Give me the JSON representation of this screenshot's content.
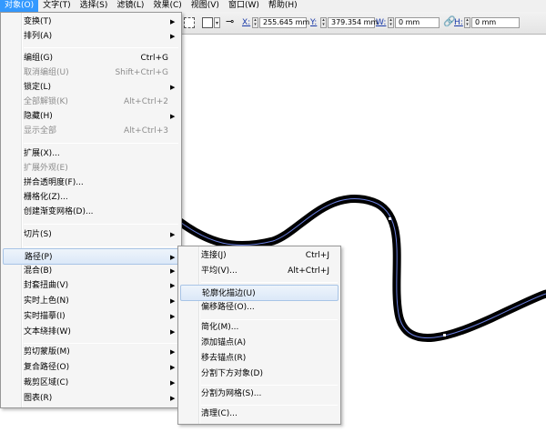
{
  "menubar": [
    {
      "label": "对象(O)",
      "active": true
    },
    {
      "label": "文字(T)"
    },
    {
      "label": "选择(S)"
    },
    {
      "label": "滤镜(L)"
    },
    {
      "label": "效果(C)"
    },
    {
      "label": "视图(V)"
    },
    {
      "label": "窗口(W)"
    },
    {
      "label": "帮助(H)"
    }
  ],
  "toolbar": {
    "x_label": "X:",
    "x_value": "255.645 mm",
    "y_label": "Y:",
    "y_value": "379.354 mm",
    "w_label": "W:",
    "w_value": "0 mm",
    "h_label": "H:",
    "h_value": "0 mm"
  },
  "object_menu": [
    {
      "label": "变换(T)",
      "submenu": true
    },
    {
      "label": "排列(A)",
      "submenu": true
    },
    {
      "separator": true
    },
    {
      "label": "编组(G)",
      "shortcut": "Ctrl+G"
    },
    {
      "label": "取消编组(U)",
      "shortcut": "Shift+Ctrl+G",
      "disabled": true
    },
    {
      "label": "锁定(L)",
      "submenu": true
    },
    {
      "label": "全部解锁(K)",
      "shortcut": "Alt+Ctrl+2",
      "disabled": true
    },
    {
      "label": "隐藏(H)",
      "submenu": true
    },
    {
      "label": "显示全部",
      "shortcut": "Alt+Ctrl+3",
      "disabled": true
    },
    {
      "separator": true
    },
    {
      "label": "扩展(X)..."
    },
    {
      "label": "扩展外观(E)",
      "disabled": true
    },
    {
      "label": "拼合透明度(F)..."
    },
    {
      "label": "栅格化(Z)..."
    },
    {
      "label": "创建渐变网格(D)..."
    },
    {
      "separator": true
    },
    {
      "label": "切片(S)",
      "submenu": true
    },
    {
      "separator": true
    },
    {
      "label": "路径(P)",
      "submenu": true,
      "highlighted": true
    },
    {
      "label": "混合(B)",
      "submenu": true
    },
    {
      "label": "封套扭曲(V)",
      "submenu": true
    },
    {
      "label": "实时上色(N)",
      "submenu": true
    },
    {
      "label": "实时描摹(I)",
      "submenu": true
    },
    {
      "label": "文本绕排(W)",
      "submenu": true
    },
    {
      "separator": true
    },
    {
      "label": "剪切蒙版(M)",
      "submenu": true
    },
    {
      "label": "复合路径(O)",
      "submenu": true
    },
    {
      "label": "裁剪区域(C)",
      "submenu": true
    },
    {
      "label": "图表(R)",
      "submenu": true
    }
  ],
  "path_submenu": [
    {
      "label": "连接(J)",
      "shortcut": "Ctrl+J"
    },
    {
      "label": "平均(V)...",
      "shortcut": "Alt+Ctrl+J"
    },
    {
      "separator": true
    },
    {
      "label": "轮廓化描边(U)",
      "highlighted": true
    },
    {
      "label": "偏移路径(O)..."
    },
    {
      "separator": true
    },
    {
      "label": "简化(M)..."
    },
    {
      "label": "添加锚点(A)"
    },
    {
      "label": "移去锚点(R)"
    },
    {
      "label": "分割下方对象(D)"
    },
    {
      "separator": true
    },
    {
      "label": "分割为网格(S)..."
    },
    {
      "separator": true
    },
    {
      "label": "清理(C)..."
    }
  ],
  "colors": {
    "menubar_active": "#3399ff",
    "path_stroke": "#000000",
    "path_center": "#6a7fe0"
  }
}
